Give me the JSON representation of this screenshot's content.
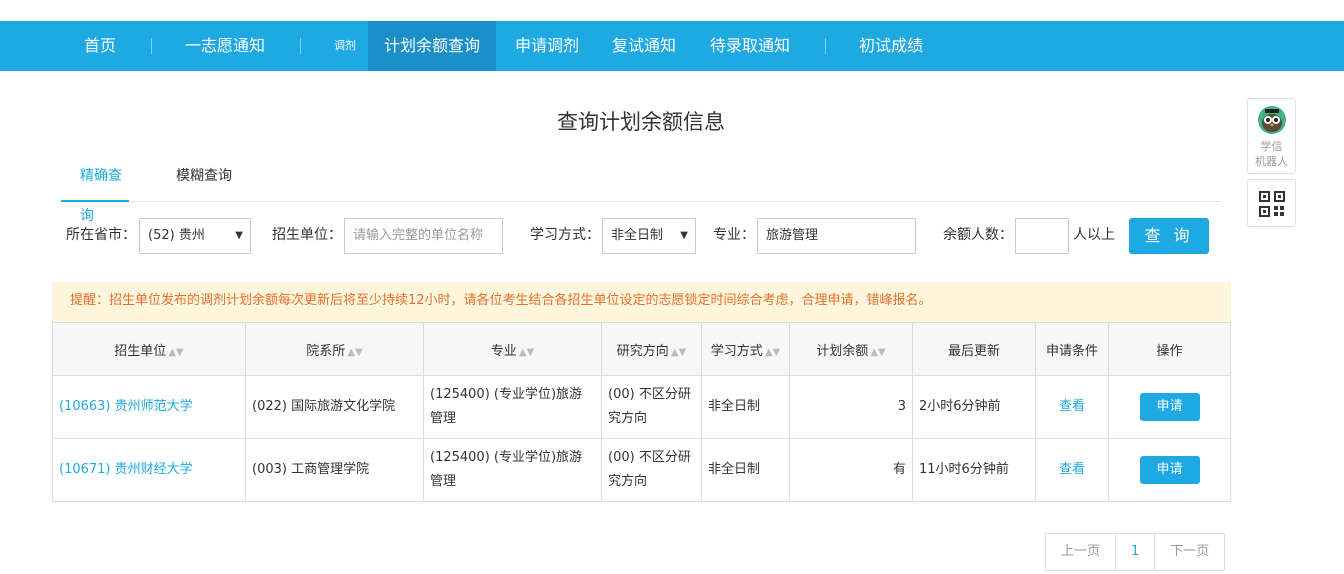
{
  "nav": {
    "items": [
      "首页",
      "一志愿通知",
      "调剂",
      "计划余额查询",
      "申请调剂",
      "复试通知",
      "待录取通知",
      "初试成绩"
    ]
  },
  "page_title": "查询计划余额信息",
  "tabs": [
    "精确查询",
    "模糊查询"
  ],
  "filters": {
    "province_label": "所在省市：",
    "province_value": "(52) 贵州",
    "unit_label": "招生单位：",
    "unit_placeholder": "请输入完整的单位名称",
    "study_label": "学习方式：",
    "study_value": "非全日制",
    "major_label": "专业：",
    "major_value": "旅游管理",
    "remain_label": "余额人数：",
    "remain_value": "",
    "remain_suffix": "人以上",
    "query_button": "查 询"
  },
  "notice": "提醒：招生单位发布的调剂计划余额每次更新后将至少持续12小时，请各位考生结合各招生单位设定的志愿锁定时间综合考虑，合理申请，错峰报名。",
  "table": {
    "headers": [
      "招生单位",
      "院系所",
      "专业",
      "研究方向",
      "学习方式",
      "计划余额",
      "最后更新",
      "申请条件",
      "操作"
    ],
    "rows": [
      {
        "unit": "(10663) 贵州师范大学",
        "dept": "(022) 国际旅游文化学院",
        "major": "(125400) (专业学位)旅游管理",
        "direction": "(00) 不区分研究方向",
        "study": "非全日制",
        "remain": "3",
        "updated": "2小时6分钟前",
        "condition": "查看",
        "action": "申请"
      },
      {
        "unit": "(10671) 贵州财经大学",
        "dept": "(003) 工商管理学院",
        "major": "(125400) (专业学位)旅游管理",
        "direction": "(00) 不区分研究方向",
        "study": "非全日制",
        "remain": "有",
        "updated": "11小时6分钟前",
        "condition": "查看",
        "action": "申请"
      }
    ]
  },
  "pager": {
    "prev": "上一页",
    "current": "1",
    "next": "下一页"
  },
  "side": {
    "robot_label": "学信\n机器人"
  },
  "colors": {
    "primary": "#1fa9e3",
    "active_nav": "#1a8fc8",
    "notice_bg": "#fdf6dc",
    "notice_text": "#e7702d"
  }
}
